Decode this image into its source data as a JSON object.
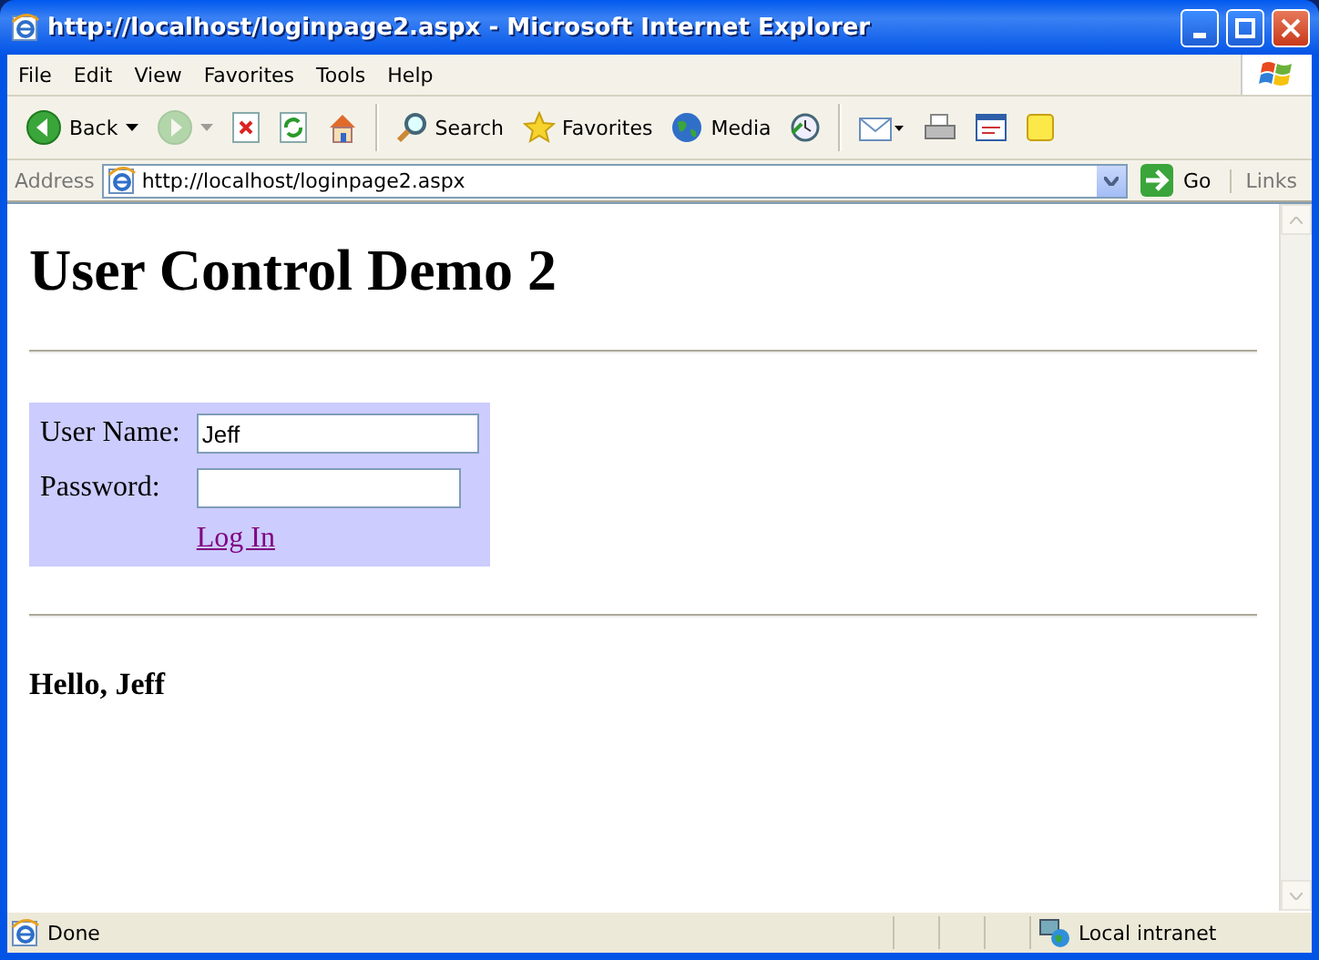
{
  "window": {
    "title": "http://localhost/loginpage2.aspx - Microsoft Internet Explorer"
  },
  "menu": [
    "File",
    "Edit",
    "View",
    "Favorites",
    "Tools",
    "Help"
  ],
  "toolbar": [
    {
      "kind": "back",
      "label": "Back",
      "disabled": false
    },
    {
      "kind": "forward",
      "disabled": true
    },
    {
      "kind": "stop",
      "disabled": false
    },
    {
      "kind": "refresh",
      "disabled": false
    },
    {
      "kind": "home",
      "disabled": false
    },
    {
      "kind": "separator"
    },
    {
      "kind": "search",
      "label": "Search",
      "disabled": false
    },
    {
      "kind": "favorites",
      "label": "Favorites",
      "disabled": false
    },
    {
      "kind": "media",
      "label": "Media",
      "disabled": false
    },
    {
      "kind": "history",
      "disabled": false
    },
    {
      "kind": "separator"
    },
    {
      "kind": "mail",
      "disabled": false
    },
    {
      "kind": "print",
      "disabled": false
    },
    {
      "kind": "edit",
      "disabled": false
    },
    {
      "kind": "note",
      "disabled": false
    }
  ],
  "address": {
    "label": "Address",
    "value": "http://localhost/loginpage2.aspx",
    "go": "Go",
    "links": "Links"
  },
  "page": {
    "heading": "User Control Demo 2",
    "login": {
      "user_label": "User Name:",
      "user_value": "Jeff",
      "password_label": "Password:",
      "link": "Log In"
    },
    "greeting": "Hello, Jeff"
  },
  "status": {
    "text": "Done",
    "zone": "Local intranet"
  }
}
